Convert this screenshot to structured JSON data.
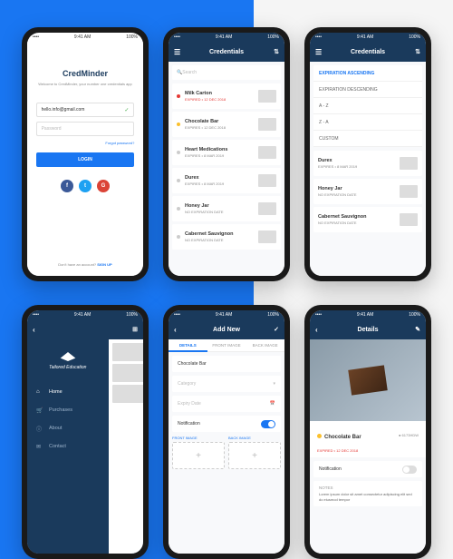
{
  "statusbar": {
    "time": "9:41 AM",
    "battery": "100%"
  },
  "login": {
    "app_name": "CredMinder",
    "subtitle": "Welcome to CredMinder, your number one\ncredentials app",
    "email": "hello.info@gmail.com",
    "password_placeholder": "Password",
    "forgot": "Forgot password?",
    "login_btn": "LOGIN",
    "signup_prompt": "Don't have an account?",
    "signup_link": "SIGN UP"
  },
  "credentials": {
    "title": "Credentials",
    "search_placeholder": "Search",
    "items": [
      {
        "name": "Milk Carton",
        "status": "EXPIRED • 12 DEC 2018",
        "expired": true
      },
      {
        "name": "Chocolate Bar",
        "status": "EXPIRES • 12 DEC 2018",
        "warning": true
      },
      {
        "name": "Heart Medications",
        "status": "EXPIRES • 8 MAR 2019"
      },
      {
        "name": "Durex",
        "status": "EXPIRES • 8 MAR 2019"
      },
      {
        "name": "Honey Jar",
        "status": "NO EXPIRATION DATE"
      },
      {
        "name": "Cabernet Sauvignon",
        "status": "NO EXPIRATION DATE"
      }
    ]
  },
  "sort": {
    "title": "Credentials",
    "options": [
      "EXPIRATION ASCENDING",
      "EXPIRATION DESCENDING",
      "A - Z",
      "Z - A",
      "CUSTOM"
    ],
    "list": [
      {
        "name": "Durex",
        "status": "EXPIRES • 8 MAR 2019"
      },
      {
        "name": "Honey Jar",
        "status": "NO EXPIRATION DATE"
      },
      {
        "name": "Cabernet Sauvignon",
        "status": "NO EXPIRATION DATE"
      }
    ]
  },
  "nav": {
    "brand": "Tailored\nEducation",
    "items": [
      {
        "icon": "⌂",
        "label": "Home",
        "active": true
      },
      {
        "icon": "🛒",
        "label": "Purchases"
      },
      {
        "icon": "ⓘ",
        "label": "About"
      },
      {
        "icon": "✉",
        "label": "Contact"
      }
    ]
  },
  "addnew": {
    "title": "Add New",
    "tabs": [
      "DETAILS",
      "FRONT IMAGE",
      "BACK IMAGE"
    ],
    "name_value": "Chocolate Bar",
    "category_placeholder": "Category",
    "expiry_placeholder": "Expiry Date",
    "notification_label": "Notification",
    "front_label": "FRONT IMAGE",
    "back_label": "BACK IMAGE"
  },
  "details": {
    "title": "Details",
    "name": "Chocolate Bar",
    "code": "● 6173HDW",
    "expired": "EXPIRED • 12 DEC 2018",
    "notification_label": "Notification",
    "notes_label": "NOTES",
    "notes_text": "Lorem ipsum dolor sit amet consectetur adipiscing elit sed do eiusmod tempor"
  }
}
